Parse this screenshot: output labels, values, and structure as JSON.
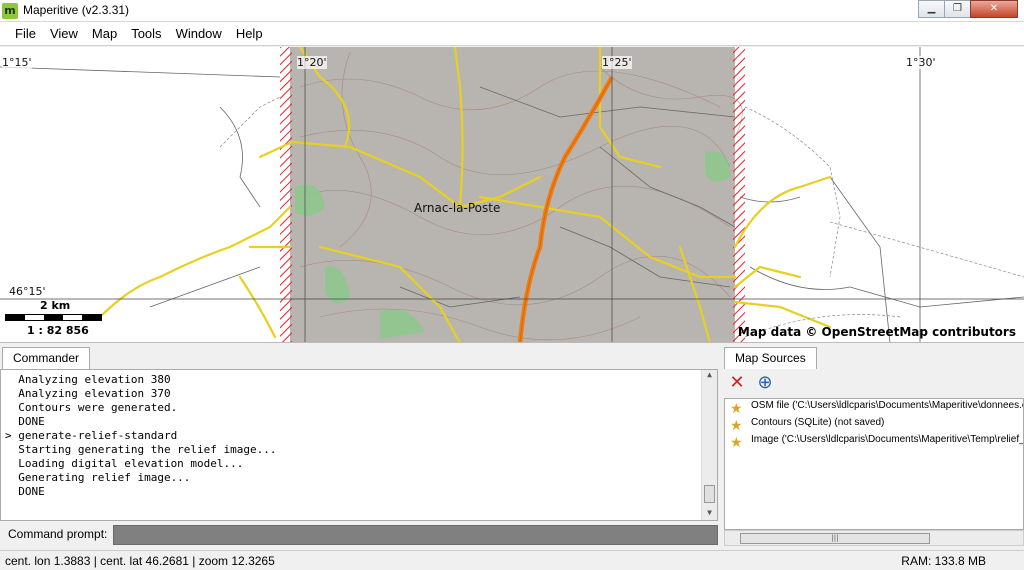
{
  "window": {
    "app_icon_letter": "m",
    "title": "Maperitive (v2.3.31)",
    "minimize_glyph": "▁",
    "maximize_glyph": "❐",
    "close_glyph": "✕"
  },
  "menu": {
    "items": [
      {
        "label": "File"
      },
      {
        "label": "View"
      },
      {
        "label": "Map"
      },
      {
        "label": "Tools"
      },
      {
        "label": "Window"
      },
      {
        "label": "Help"
      }
    ]
  },
  "map": {
    "lon_labels": [
      "1°15'",
      "1°20'",
      "1°25'",
      "1°30'"
    ],
    "lat_label": "46°15'",
    "scale_distance": "2 km",
    "scale_ratio": "1 : 82 856",
    "attribution": "Map data © OpenStreetMap contributors",
    "town_label": "Arnac-la-Poste",
    "colors": {
      "boundary_hatch": "#e8202a",
      "relief_gray": "#b8b4b0",
      "motorway": "#f07d12",
      "primary_road": "#f0d818",
      "forest": "#8cc88c"
    }
  },
  "commander": {
    "tab_label": "Commander",
    "lines": [
      "  Analyzing elevation 380",
      "  Analyzing elevation 370",
      "  Contours were generated.",
      "  DONE",
      "> generate-relief-standard",
      "  Starting generating the relief image...",
      "  Loading digital elevation model...",
      "  Generating relief image...",
      "  DONE"
    ],
    "prompt_label": "Command prompt:",
    "prompt_value": ""
  },
  "map_sources": {
    "tab_label": "Map Sources",
    "remove_icon": "✕",
    "zoom_icon": "⊕",
    "items": [
      {
        "label": "OSM file ('C:\\Users\\ldlcparis\\Documents\\Maperitive\\donnees.osm"
      },
      {
        "label": "Contours (SQLite) (not saved)"
      },
      {
        "label": "Image ('C:\\Users\\ldlcparis\\Documents\\Maperitive\\Temp\\relief_"
      }
    ]
  },
  "status": {
    "left": "cent. lon 1.3883 | cent. lat 46.2681 | zoom 12.3265",
    "right": "RAM: 133.8 MB"
  }
}
